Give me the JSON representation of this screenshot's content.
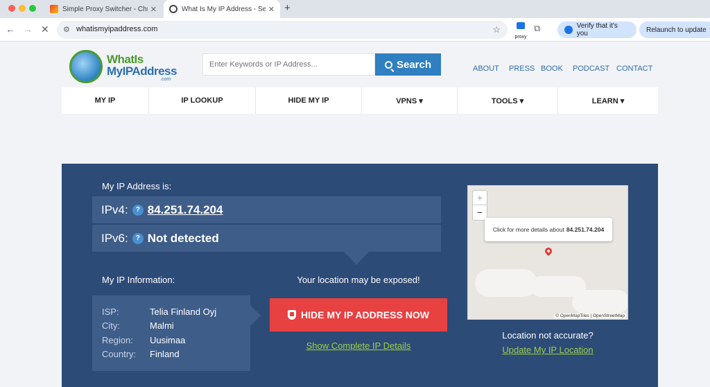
{
  "browser": {
    "tabs": [
      {
        "title": "Simple Proxy Switcher - Chro",
        "active": false
      },
      {
        "title": "What Is My IP Address - See",
        "active": true
      }
    ],
    "url": "whatismyipaddress.com",
    "proxy_ext_label": "proxy",
    "verify_label": "Verify that it's you",
    "relaunch_label": "Relaunch to update"
  },
  "site": {
    "logo": {
      "line1": "WhatIs",
      "line2": "MyIPAddress",
      "line3": ".com"
    },
    "search": {
      "placeholder": "Enter Keywords or IP Address...",
      "button": "Search"
    },
    "top_links": [
      "ABOUT",
      "PRESS",
      "BOOK",
      "PODCAST",
      "CONTACT"
    ],
    "main_nav": [
      "MY IP",
      "IP LOOKUP",
      "HIDE MY IP",
      "VPNS ▾",
      "TOOLS ▾",
      "LEARN ▾"
    ]
  },
  "ip_panel": {
    "heading": "My IP Address is:",
    "ipv4_label": "IPv4:",
    "ipv4_value": "84.251.74.204",
    "ipv6_label": "IPv6:",
    "ipv6_value": "Not detected",
    "info_heading": "My IP Information:",
    "info": [
      {
        "label": "ISP:",
        "value": "Telia Finland Oyj"
      },
      {
        "label": "City:",
        "value": "Malmi"
      },
      {
        "label": "Region:",
        "value": "Uusimaa"
      },
      {
        "label": "Country:",
        "value": "Finland"
      }
    ],
    "exposed_text": "Your location may be exposed!",
    "hide_button": "HIDE MY IP ADDRESS NOW",
    "show_details": "Show Complete IP Details",
    "map_popup_text": "Click for more details about",
    "map_popup_ip": "84.251.74.204",
    "map_attribution": "© OpenMapTiles | OpenStreetMap",
    "not_accurate": "Location not accurate?",
    "update_location": "Update My IP Location"
  },
  "colors": {
    "panel": "#2d4b77",
    "panel_box": "#3e5d89",
    "cta_red": "#e84141",
    "link_green": "#9bd04a",
    "search_blue": "#2f7fc1"
  }
}
